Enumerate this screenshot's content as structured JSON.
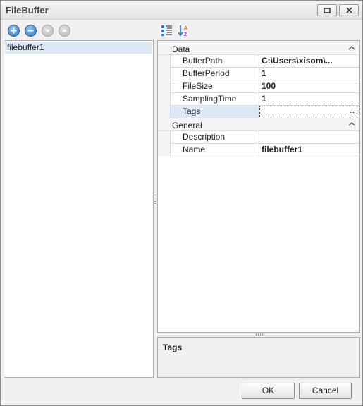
{
  "window": {
    "title": "FileBuffer"
  },
  "left_panel": {
    "toolbar": [
      "add-circle-icon",
      "remove-circle-icon",
      "move-down-circle-icon",
      "move-up-circle-icon"
    ],
    "items": [
      {
        "label": "filebuffer1",
        "selected": true
      }
    ]
  },
  "property_grid": {
    "toolbar": [
      "categorized-icon",
      "alphabetical-sort-icon"
    ],
    "categories": [
      {
        "label": "Data",
        "properties": [
          {
            "name": "BufferPath",
            "value": "C:\\Users\\xisom\\..."
          },
          {
            "name": "BufferPeriod",
            "value": "1"
          },
          {
            "name": "FileSize",
            "value": "100"
          },
          {
            "name": "SamplingTime",
            "value": "1"
          },
          {
            "name": "Tags",
            "value": "",
            "selected": true,
            "ellipsis": "..."
          }
        ]
      },
      {
        "label": "General",
        "properties": [
          {
            "name": "Description",
            "value": ""
          },
          {
            "name": "Name",
            "value": "filebuffer1"
          }
        ]
      }
    ],
    "description_title": "Tags"
  },
  "buttons": {
    "ok": "OK",
    "cancel": "Cancel"
  },
  "colors": {
    "selection": "#dde8f6",
    "accent_blue": "#2f77c6",
    "border": "#adadad"
  }
}
